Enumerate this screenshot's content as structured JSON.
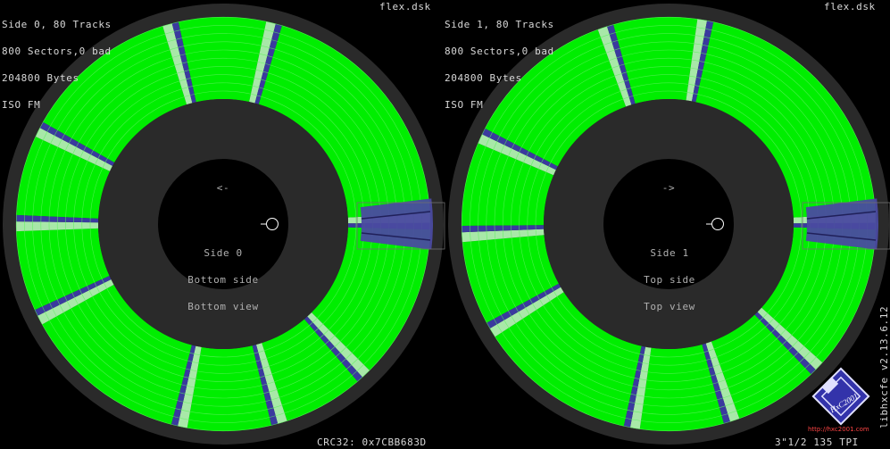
{
  "disks": [
    {
      "info_lines": [
        "Side 0, 80 Tracks",
        "800 Sectors,0 bad",
        "204800 Bytes",
        "ISO FM"
      ],
      "filename": "flex.dsk",
      "direction_arrow": "<-",
      "center_lines": [
        "Side 0",
        "Bottom side",
        "Bottom view"
      ]
    },
    {
      "info_lines": [
        "Side 1, 80 Tracks",
        "800 Sectors,0 bad",
        "204800 Bytes",
        "ISO FM"
      ],
      "filename": "flex.dsk",
      "direction_arrow": "->",
      "center_lines": [
        "Side 1",
        "Top side",
        "Top view"
      ]
    }
  ],
  "footer": {
    "crc": "CRC32: 0x7CBB683D",
    "drive_info": "3\"1/2 135 TPI",
    "library_version": "libhxcfe v2.13.6.12",
    "logo_text": "HxC2001",
    "logo_url": "http://hxc2001.com"
  },
  "colors": {
    "background": "#000000",
    "platter": "#2a2a2a",
    "sector_ok": "#00ee00",
    "sector_gap": "#a8e8a8",
    "sector_boundary": "#3a3a9e",
    "index_window": "#4a4aa0",
    "text": "#d8d8d8"
  },
  "icons": [
    "index-hole-icon",
    "hxc2001-logo-icon"
  ]
}
